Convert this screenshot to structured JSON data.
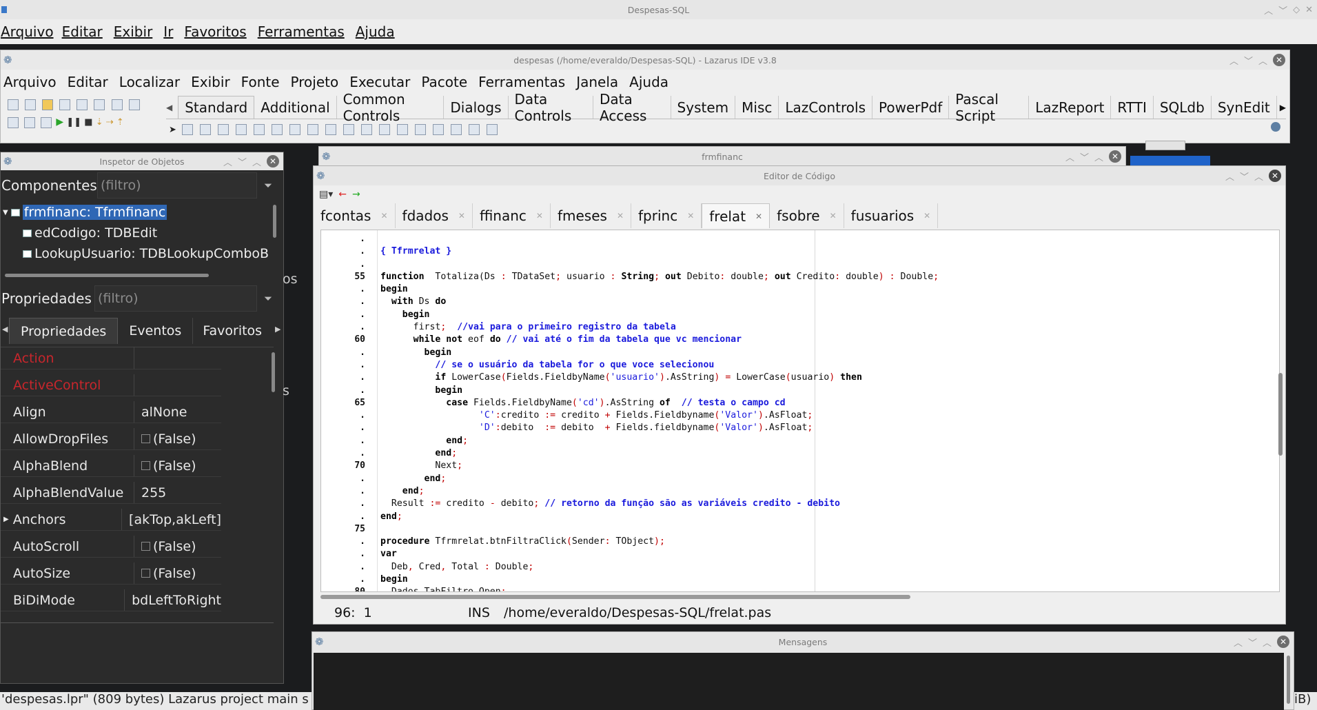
{
  "outer_window": {
    "title": "Despesas-SQL",
    "menu": [
      "Arquivo",
      "Editar",
      "Exibir",
      "Ir",
      "Favoritos",
      "Ferramentas",
      "Ajuda"
    ],
    "status_left": "'despesas.lpr\" (809 bytes) Lazarus project main s",
    "status_right": "iB)"
  },
  "ide": {
    "title": "despesas (/home/everaldo/Despesas-SQL) - Lazarus IDE v3.8",
    "menu": [
      "Arquivo",
      "Editar",
      "Localizar",
      "Exibir",
      "Fonte",
      "Projeto",
      "Executar",
      "Pacote",
      "Ferramentas",
      "Janela",
      "Ajuda"
    ],
    "palette_tabs": [
      "Standard",
      "Additional",
      "Common Controls",
      "Dialogs",
      "Data Controls",
      "Data Access",
      "System",
      "Misc",
      "LazControls",
      "PowerPdf",
      "Pascal Script",
      "LazReport",
      "RTTI",
      "SQLdb",
      "SynEdit"
    ],
    "active_palette_tab": "Standard"
  },
  "inspector": {
    "title": "Inspetor de Objetos",
    "components_label": "Componentes",
    "filter_placeholder": "(filtro)",
    "tree": [
      "frmfinanc: Tfrmfinanc",
      "edCodigo: TDBEdit",
      "LookupUsuario: TDBLookupComboB"
    ],
    "properties_label": "Propriedades",
    "tabs": [
      "Propriedades",
      "Eventos",
      "Favoritos"
    ],
    "props": [
      {
        "name": "Action",
        "value": "",
        "red": true
      },
      {
        "name": "ActiveControl",
        "value": "",
        "red": true
      },
      {
        "name": "Align",
        "value": "alNone"
      },
      {
        "name": "AllowDropFiles",
        "value": "(False)",
        "check": true
      },
      {
        "name": "AlphaBlend",
        "value": "(False)",
        "check": true
      },
      {
        "name": "AlphaBlendValue",
        "value": "255"
      },
      {
        "name": "Anchors",
        "value": "[akTop,akLeft]",
        "expand": true
      },
      {
        "name": "AutoScroll",
        "value": "(False)",
        "check": true
      },
      {
        "name": "AutoSize",
        "value": "(False)",
        "check": true
      },
      {
        "name": "BiDiMode",
        "value": "bdLeftToRight"
      }
    ],
    "peek_text_1": "os",
    "peek_text_2": "s"
  },
  "form_window": {
    "title": "frmfinanc"
  },
  "editor": {
    "title": "Editor de Código",
    "tabs": [
      "fcontas",
      "fdados",
      "ffinanc",
      "fmeses",
      "fprinc",
      "frelat",
      "fsobre",
      "fusuarios"
    ],
    "active_tab": "frelat",
    "gutter": [
      ".",
      ".",
      ".",
      "55",
      ".",
      ".",
      ".",
      ".",
      "60",
      ".",
      ".",
      ".",
      ".",
      "65",
      ".",
      ".",
      ".",
      ".",
      "70",
      ".",
      ".",
      ".",
      ".",
      "75",
      ".",
      ".",
      ".",
      ".",
      "80"
    ],
    "status_pos": "96:  1",
    "status_mode": "INS",
    "status_file": "/home/everaldo/Despesas-SQL/frelat.pas"
  },
  "messages": {
    "title": "Mensagens"
  }
}
